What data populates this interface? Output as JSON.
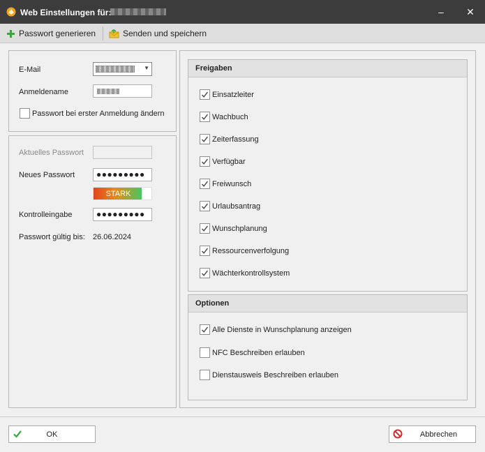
{
  "window": {
    "title": "Web Einstellungen für:",
    "minimize": "–",
    "close": "✕"
  },
  "toolbar": {
    "generate_label": "Passwort generieren",
    "send_save_label": "Senden und speichern"
  },
  "account": {
    "email_label": "E-Mail",
    "login_label": "Anmeldename",
    "change_on_login_label": "Passwort bei erster Anmeldung ändern",
    "change_on_login_checked": false
  },
  "password": {
    "current_label": "Aktuelles Passwort",
    "new_label": "Neues Passwort",
    "new_value": "●●●●●●●●●",
    "strength_label": "STARK",
    "strength_fraction": 0.83,
    "confirm_label": "Kontrolleingabe",
    "confirm_value": "●●●●●●●●●",
    "valid_until_label": "Passwort gültig bis:",
    "valid_until_value": "26.06.2024"
  },
  "freigaben": {
    "title": "Freigaben",
    "items": [
      {
        "label": "Einsatzleiter",
        "checked": true
      },
      {
        "label": "Wachbuch",
        "checked": true
      },
      {
        "label": "Zeiterfassung",
        "checked": true
      },
      {
        "label": "Verfügbar",
        "checked": true
      },
      {
        "label": "Freiwunsch",
        "checked": true
      },
      {
        "label": "Urlaubsantrag",
        "checked": true
      },
      {
        "label": "Wunschplanung",
        "checked": true
      },
      {
        "label": "Ressourcenverfolgung",
        "checked": true
      },
      {
        "label": "Wächterkontrollsystem",
        "checked": true
      }
    ]
  },
  "optionen": {
    "title": "Optionen",
    "items": [
      {
        "label": "Alle Dienste in Wunschplanung anzeigen",
        "checked": true
      },
      {
        "label": "NFC Beschreiben erlauben",
        "checked": false
      },
      {
        "label": "Dienstausweis Beschreiben erlauben",
        "checked": false
      }
    ]
  },
  "footer": {
    "ok_label": "OK",
    "cancel_label": "Abbrechen"
  },
  "colors": {
    "titlebar": "#3c3c3c",
    "check": "#444444",
    "ok_icon": "#3aa63a",
    "cancel_icon": "#d42a2a"
  }
}
